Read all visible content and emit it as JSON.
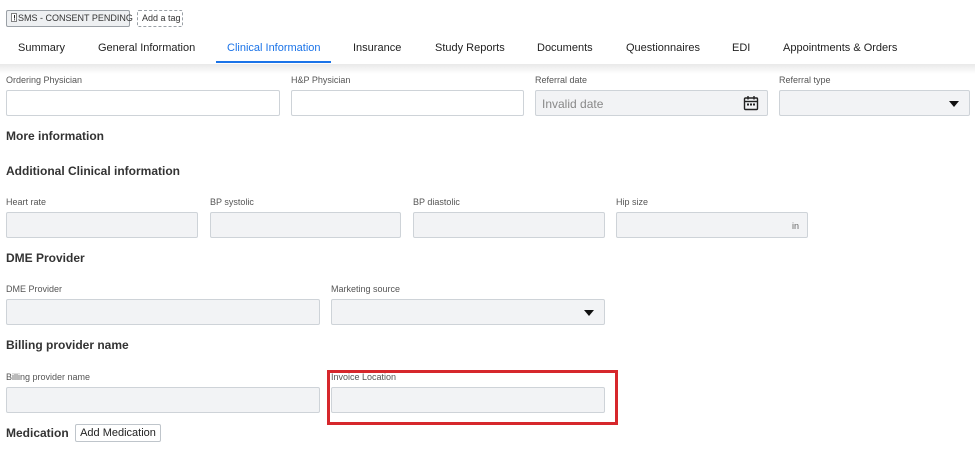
{
  "tags": {
    "sms_consent": "SMS - CONSENT PENDING",
    "add_tag": "Add a tag"
  },
  "tabs": [
    {
      "label": "Summary"
    },
    {
      "label": "General Information"
    },
    {
      "label": "Clinical Information",
      "active": true
    },
    {
      "label": "Insurance"
    },
    {
      "label": "Study Reports"
    },
    {
      "label": "Documents"
    },
    {
      "label": "Questionnaires"
    },
    {
      "label": "EDI"
    },
    {
      "label": "Appointments & Orders"
    }
  ],
  "referral": {
    "ordering_physician_label": "Ordering Physician",
    "hp_physician_label": "H&P Physician",
    "referral_date_label": "Referral date",
    "referral_date_value": "Invalid date",
    "referral_type_label": "Referral type"
  },
  "sections": {
    "more_info": "More information",
    "additional_clinical": "Additional Clinical information",
    "dme_provider": "DME Provider",
    "billing_provider": "Billing provider name",
    "medication": "Medication"
  },
  "clinical": {
    "heart_rate_label": "Heart rate",
    "bp_systolic_label": "BP systolic",
    "bp_diastolic_label": "BP diastolic",
    "hip_size_label": "Hip size",
    "hip_size_unit": "in"
  },
  "dme": {
    "dme_provider_label": "DME Provider",
    "marketing_source_label": "Marketing source"
  },
  "billing": {
    "billing_provider_label": "Billing provider name",
    "invoice_location_label": "Invoice Location"
  },
  "medication": {
    "add_button": "Add Medication"
  },
  "colors": {
    "accent": "#1a73e8",
    "highlight": "#d6272c",
    "field_bg": "#f2f3f5"
  },
  "icons": {
    "calendar": "calendar-icon",
    "dropdown": "chevron-down-icon",
    "tag": "tag-icon"
  }
}
